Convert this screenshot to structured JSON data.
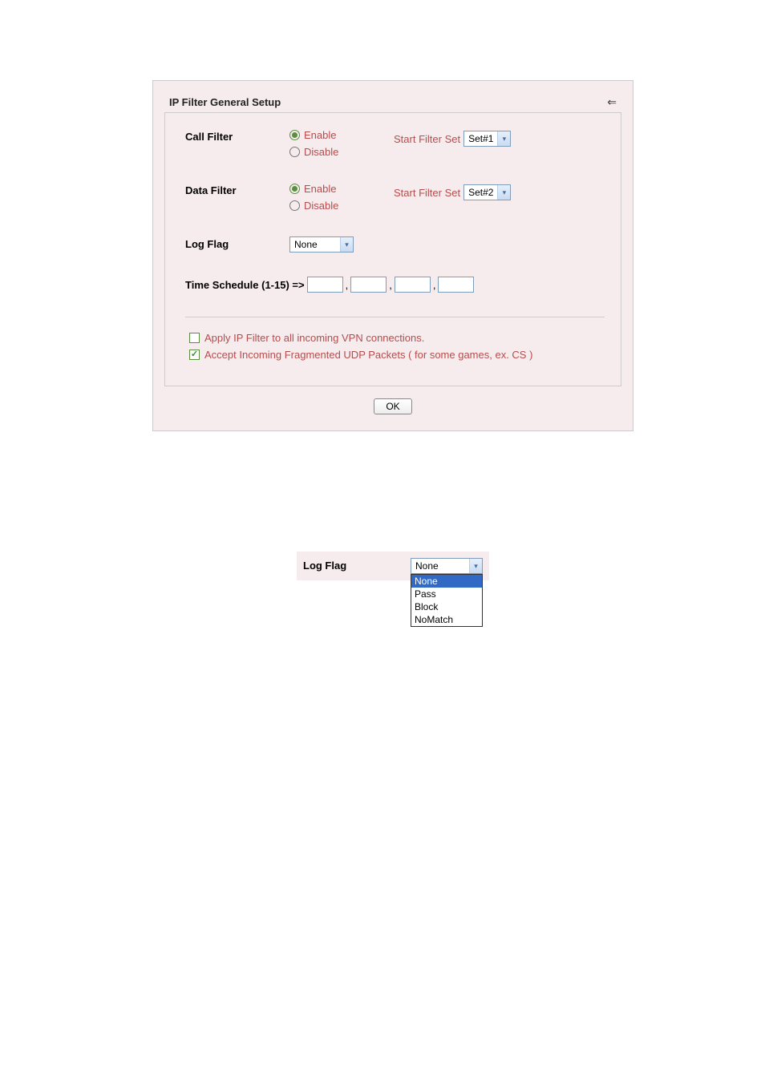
{
  "panel": {
    "title": "IP Filter General Setup",
    "back_icon": "⇐"
  },
  "callFilter": {
    "label": "Call Filter",
    "enable": "Enable",
    "disable": "Disable",
    "startLabel": "Start Filter Set",
    "startValue": "Set#1"
  },
  "dataFilter": {
    "label": "Data Filter",
    "enable": "Enable",
    "disable": "Disable",
    "startLabel": "Start Filter Set",
    "startValue": "Set#2"
  },
  "logFlag": {
    "label": "Log Flag",
    "value": "None"
  },
  "timeSchedule": {
    "label": "Time Schedule (1-15) =>",
    "sep": ","
  },
  "checks": {
    "vpn": "Apply IP Filter to all incoming VPN connections.",
    "udp": "Accept Incoming Fragmented UDP Packets ( for some games, ex. CS )"
  },
  "okButton": "OK",
  "dropdownExample": {
    "label": "Log Flag",
    "value": "None",
    "options": {
      "o0": "None",
      "o1": "Pass",
      "o2": "Block",
      "o3": "NoMatch"
    }
  }
}
